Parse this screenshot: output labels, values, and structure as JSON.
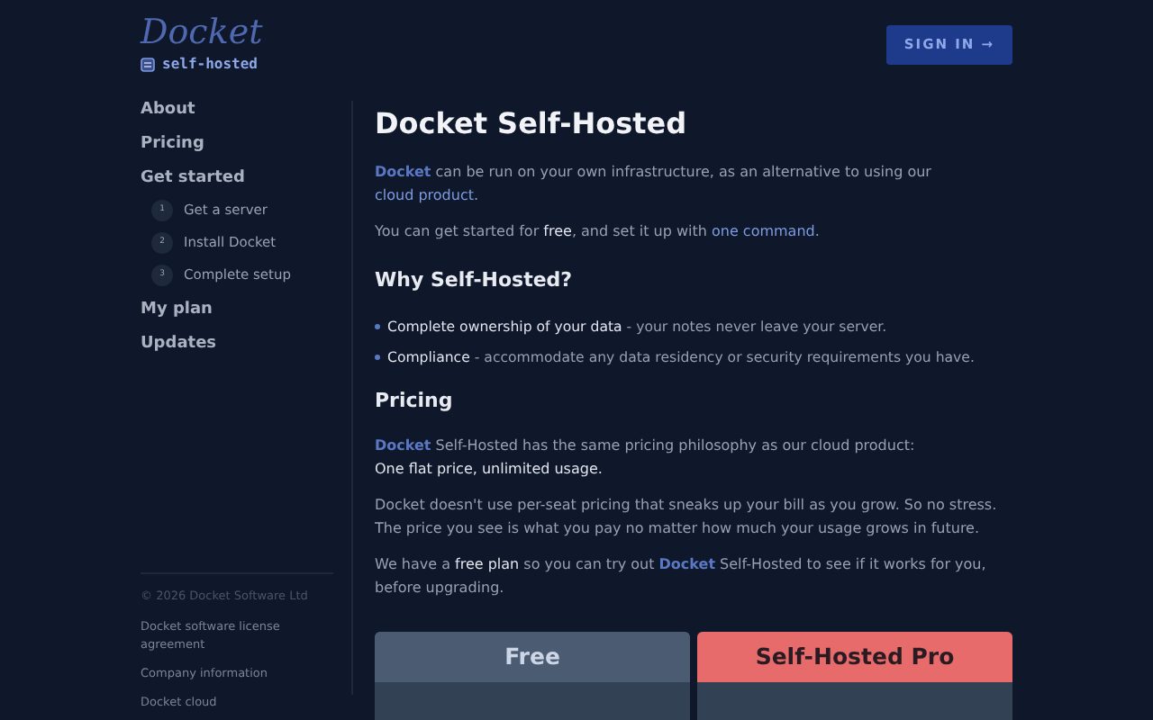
{
  "header": {
    "logo": "Docket",
    "tagline": "self-hosted",
    "sign_in": "SIGN IN →"
  },
  "sidebar": {
    "items": [
      {
        "label": "About"
      },
      {
        "label": "Pricing"
      },
      {
        "label": "Get started",
        "children": [
          {
            "number": "1",
            "label": "Get a server"
          },
          {
            "number": "2",
            "label": "Install Docket"
          },
          {
            "number": "3",
            "label": "Complete setup"
          }
        ]
      },
      {
        "label": "My plan"
      },
      {
        "label": "Updates"
      }
    ],
    "footer": {
      "copyright": "© 2026 Docket Software Ltd",
      "links": [
        "Docket software license agreement",
        "Company information",
        "Docket cloud"
      ]
    }
  },
  "main": {
    "title": "Docket Self-Hosted",
    "blocks": [
      {
        "kind": "paragraph",
        "segments": [
          {
            "kind": "brand",
            "text": "Docket"
          },
          {
            "kind": "text",
            "text": " can be run on your own infrastructure, as an alternative to using our "
          },
          {
            "kind": "link",
            "text": "cloud product"
          },
          {
            "kind": "text",
            "text": "."
          }
        ]
      },
      {
        "kind": "paragraph",
        "segments": [
          {
            "kind": "text",
            "text": "You can get started for "
          },
          {
            "kind": "strong",
            "text": "free"
          },
          {
            "kind": "text",
            "text": ", and set it up with "
          },
          {
            "kind": "link",
            "text": "one command"
          },
          {
            "kind": "text",
            "text": "."
          }
        ]
      },
      {
        "kind": "heading",
        "text": "Why Self-Hosted?"
      },
      {
        "kind": "bullet",
        "segments": [
          {
            "kind": "strong",
            "text": "Complete ownership of your data"
          },
          {
            "kind": "text",
            "text": " - your notes never leave your server."
          }
        ]
      },
      {
        "kind": "bullet",
        "segments": [
          {
            "kind": "strong",
            "text": "Compliance"
          },
          {
            "kind": "text",
            "text": " - accommodate any data residency or security requirements you have."
          }
        ]
      },
      {
        "kind": "heading",
        "text": "Pricing"
      },
      {
        "kind": "paragraph",
        "segments": [
          {
            "kind": "brand",
            "text": "Docket"
          },
          {
            "kind": "text",
            "text": " Self-Hosted has the same pricing philosophy as our cloud product:"
          },
          {
            "kind": "break"
          },
          {
            "kind": "strong",
            "text": "One flat price, unlimited usage."
          }
        ]
      },
      {
        "kind": "paragraph",
        "segments": [
          {
            "kind": "text",
            "text": "Docket doesn't use per-seat pricing that sneaks up your bill as you grow. So no stress. The price you see is what you pay no matter how much your usage grows in future."
          }
        ]
      },
      {
        "kind": "paragraph",
        "segments": [
          {
            "kind": "text",
            "text": "We have a "
          },
          {
            "kind": "strong",
            "text": "free plan"
          },
          {
            "kind": "text",
            "text": " so you can try out "
          },
          {
            "kind": "brand",
            "text": "Docket"
          },
          {
            "kind": "text",
            "text": " Self-Hosted to see if it works for you, before upgrading."
          }
        ]
      }
    ],
    "plans": [
      {
        "name": "Free",
        "highlighted": false
      },
      {
        "name": "Self-Hosted Pro",
        "highlighted": true
      }
    ]
  }
}
